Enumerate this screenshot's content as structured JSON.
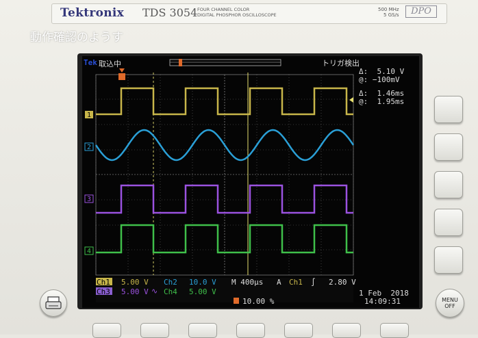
{
  "brand": "Tektronix",
  "model": "TDS 3054",
  "model_desc_1": "FOUR CHANNEL COLOR",
  "model_desc_2": "DIGITAL PHOSPHOR OSCILLOSCOPE",
  "spec_1": "500 MHz",
  "spec_2": "5 GS/s",
  "series_badge": "DPO",
  "overlay_title": "動作確認のようす",
  "status": {
    "tek_logo": "Tek",
    "acquisition": "取込中",
    "trigger_state": "トリガ検出"
  },
  "cursor_readout": {
    "delta_v": "Δ:  5.10 V",
    "at_v": "@: −100mV",
    "delta_t": "Δ:  1.46ms",
    "at_t": "@:  1.95ms"
  },
  "channels": {
    "ch1_label": "Ch1",
    "ch1_scale": "5.00 V",
    "ch2_label": "Ch2",
    "ch2_scale": "10.0 V",
    "ch3_label": "Ch3",
    "ch3_scale": "5.00 V",
    "ch4_label": "Ch4",
    "ch4_scale": "5.00 V",
    "ch1_marker": "1",
    "ch2_marker": "2",
    "ch3_marker": "3",
    "ch4_marker": "4"
  },
  "timebase": "M 400µs",
  "trigger": {
    "mode": "A",
    "source": "Ch1",
    "slope": "∫",
    "level": "2.80 V"
  },
  "trigger_position": "10.00 %",
  "date": "1 Feb  2018",
  "time": "14:09:31",
  "menu_button": {
    "line1": "MENU",
    "line2": "OFF"
  },
  "colors": {
    "ch1": "#c8b64a",
    "ch2": "#2a9fd6",
    "ch3": "#9b52e0",
    "ch4": "#3fbf4a",
    "cursor": "#e8e070",
    "trigger": "#e06a2a"
  }
}
